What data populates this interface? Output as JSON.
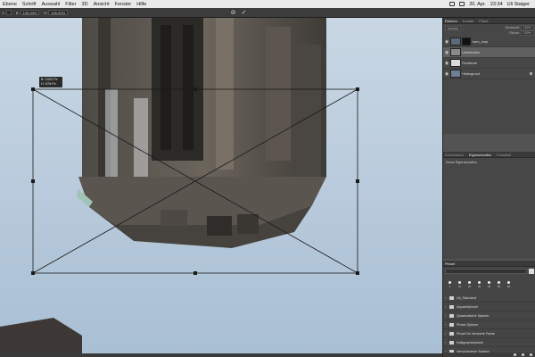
{
  "menubar": {
    "items": [
      "Ebene",
      "Schrift",
      "Auswahl",
      "Filter",
      "3D",
      "Ansicht",
      "Fenster",
      "Hilfe"
    ],
    "date": "20. Apr.",
    "time": "23:34",
    "user": "Uli Staiger"
  },
  "options_bar": {
    "x_label": "X:",
    "x_value": "",
    "w_label": "B:",
    "w_value": "100,00%",
    "h_label": "H:",
    "h_value": "100,00%",
    "cancel_icon": "cancel-icon",
    "commit_icon": "commit-check-icon"
  },
  "canvas": {
    "readout_line1": "B: 1022 Px",
    "readout_line2": "H: 578 Px",
    "sky_color": "#b5c7d8"
  },
  "layers_panel": {
    "tabs": [
      "Ebenen",
      "Kanäle",
      "Pfade"
    ],
    "blend_mode": "Normal",
    "opacity_label": "Deckkraft:",
    "opacity_value": "100%",
    "fill_label": "Fläche:",
    "fill_value": "100%",
    "layers": [
      {
        "name": "turm_crop",
        "selected": false,
        "has_mask": true,
        "thumb": "#5a6a7a"
      },
      {
        "name": "Unterboden",
        "selected": true,
        "has_mask": false,
        "thumb": "#8a8a8a"
      },
      {
        "name": "Fensterne",
        "selected": false,
        "has_mask": false,
        "thumb": "#d9d9d9"
      },
      {
        "name": "Hintergrund",
        "selected": false,
        "has_mask": false,
        "thumb": "#6d7f95"
      }
    ]
  },
  "properties_panel": {
    "tabs": [
      "Korrekturen",
      "Eigenschaften",
      "Protokoll"
    ],
    "text": "Keine Eigenschaften"
  },
  "brush_panel": {
    "title": "Pinsel",
    "preset_sizes": [
      "1",
      "10",
      "20",
      "30",
      "40",
      "50",
      "60"
    ],
    "groups": [
      "Uli_Standard",
      "Aquarellpinsel",
      "Quadratische Spitzen",
      "Pinsel-Spitzen",
      "Pinsel für Verzierte Farbe",
      "Kalligraphiepinsel",
      "Verschiedene Spitzen"
    ]
  },
  "colors": {
    "panel_bg": "#535353",
    "selection": "#616161",
    "canvas_dark": "#2b2b2b"
  }
}
